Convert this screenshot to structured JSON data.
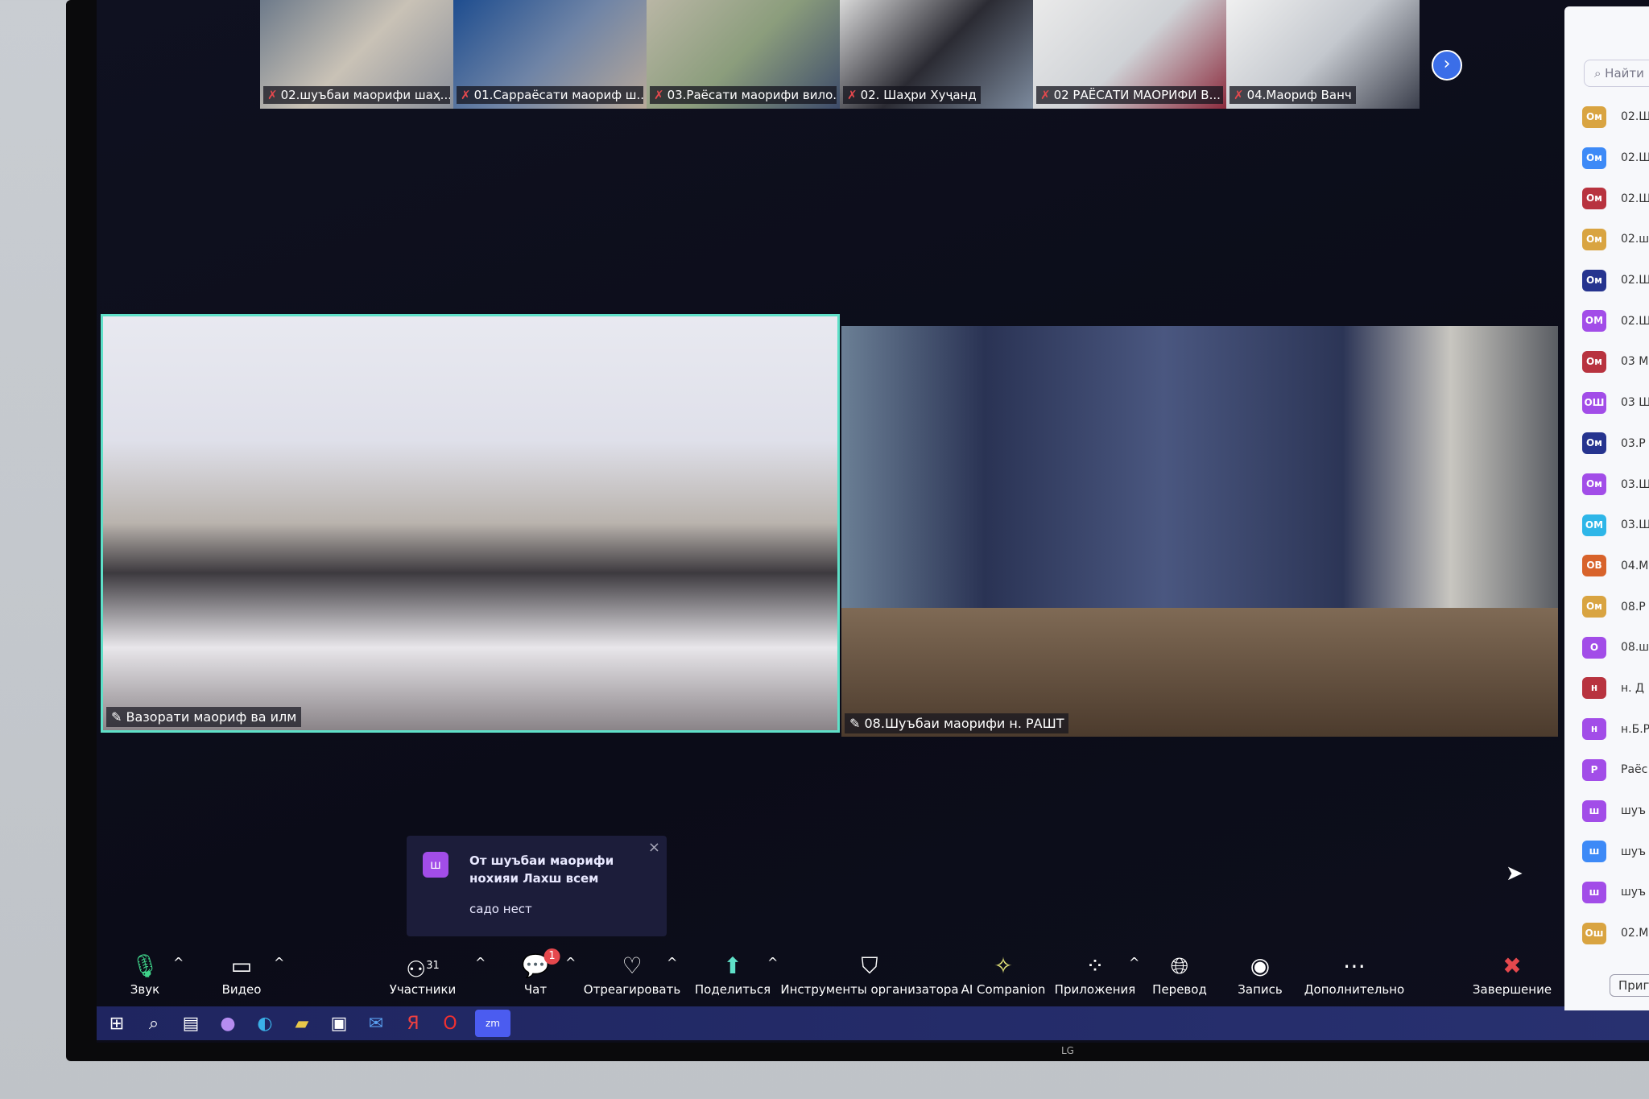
{
  "gallery": {
    "thumbnails": [
      {
        "name": "02.шуъбаи маорифи шаҳ..."
      },
      {
        "name": "01.Сарраёсати маориф ш..."
      },
      {
        "name": "03.Раёсати маорифи вило..."
      },
      {
        "name": "02. Шаҳри Хуҷанд"
      },
      {
        "name": "02 РАЁСАТИ МАОРИФИ В..."
      },
      {
        "name": "04.Маориф Ванч"
      }
    ],
    "next_icon": "chevron-right-icon"
  },
  "main_videos": [
    {
      "name": "Вазорати маориф ва илм",
      "active_speaker": true
    },
    {
      "name": "08.Шуъбаи маорифи н. РАШТ"
    }
  ],
  "notification": {
    "avatar": "ш",
    "title": "От шуъбаи маорифи нохияи Лахш всем",
    "message": "садо нест",
    "close": "×"
  },
  "toolbar": {
    "audio": "Звук",
    "video": "Видео",
    "participants": "Участники",
    "participants_count": "31",
    "chat": "Чат",
    "chat_badge": "1",
    "react": "Отреагировать",
    "share": "Поделиться",
    "host_tools": "Инструменты организатора",
    "ai": "AI Companion",
    "apps": "Приложения",
    "translate": "Перевод",
    "record": "Запись",
    "more": "Дополнительно",
    "end": "Завершение"
  },
  "sidebar": {
    "search_placeholder": "Найти",
    "invite": "Приг",
    "participants": [
      {
        "initials": "Ом",
        "name": "02.Ш",
        "color": "#d9a441"
      },
      {
        "initials": "Ом",
        "name": "02.Ш",
        "color": "#3d8af7"
      },
      {
        "initials": "Ом",
        "name": "02.Ш",
        "color": "#b8333f"
      },
      {
        "initials": "Ом",
        "name": "02.ш",
        "color": "#d9a441"
      },
      {
        "initials": "Ом",
        "name": "02.Ш",
        "color": "#26348f"
      },
      {
        "initials": "ОМ",
        "name": "02.Ш",
        "color": "#a24de8"
      },
      {
        "initials": "Ом",
        "name": "03 М",
        "color": "#b8333f"
      },
      {
        "initials": "ОШ",
        "name": "03 Ш",
        "color": "#a24de8"
      },
      {
        "initials": "Ом",
        "name": "03.Р",
        "color": "#26348f"
      },
      {
        "initials": "Ом",
        "name": "03.Ш",
        "color": "#a24de8"
      },
      {
        "initials": "ОМ",
        "name": "03.Ш",
        "color": "#2eb6e8"
      },
      {
        "initials": "ОВ",
        "name": "04.М",
        "color": "#d8632b"
      },
      {
        "initials": "Ом",
        "name": "08.Р",
        "color": "#d9a441"
      },
      {
        "initials": "О",
        "name": "08.ш",
        "color": "#a24de8"
      },
      {
        "initials": "н",
        "name": "н. Д",
        "color": "#b8333f"
      },
      {
        "initials": "н",
        "name": "н.Б.Р",
        "color": "#a24de8"
      },
      {
        "initials": "Р",
        "name": "Раёс",
        "color": "#a24de8"
      },
      {
        "initials": "ш",
        "name": "шуъ",
        "color": "#a24de8"
      },
      {
        "initials": "ш",
        "name": "шуъ",
        "color": "#3d8af7"
      },
      {
        "initials": "ш",
        "name": "шуъ",
        "color": "#a24de8"
      },
      {
        "initials": "Ош",
        "name": "02.М",
        "color": "#d9a441"
      }
    ]
  },
  "tv_brand": "LG"
}
